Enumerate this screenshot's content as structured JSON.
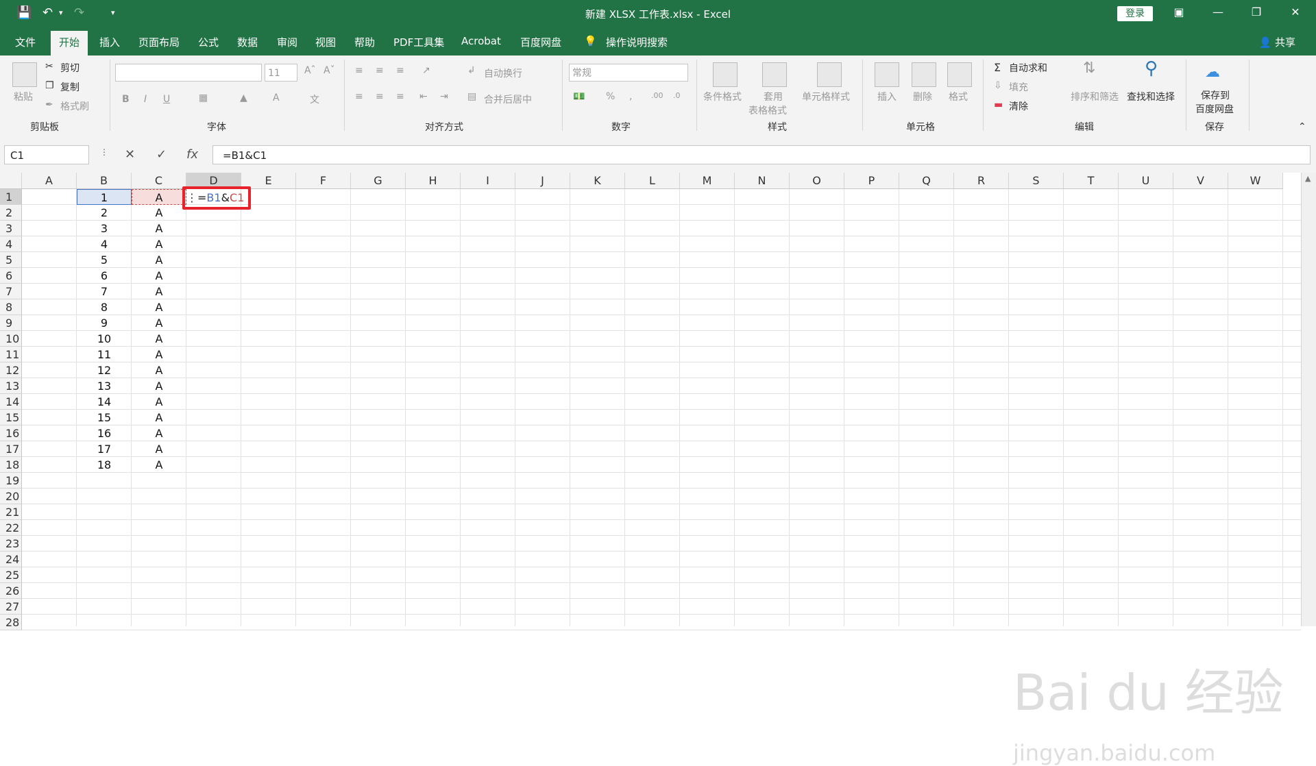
{
  "window": {
    "title": "新建 XLSX 工作表.xlsx  -  Excel",
    "login": "登录"
  },
  "tabs": [
    "文件",
    "开始",
    "插入",
    "页面布局",
    "公式",
    "数据",
    "审阅",
    "视图",
    "帮助",
    "PDF工具集",
    "Acrobat",
    "百度网盘"
  ],
  "tell_me": "操作说明搜索",
  "share": "共享",
  "ribbon": {
    "clipboard": {
      "label": "剪贴板",
      "paste": "粘贴",
      "cut": "剪切",
      "copy": "复制",
      "format_painter": "格式刷"
    },
    "font": {
      "label": "字体",
      "size": "11",
      "bold": "B",
      "italic": "I",
      "underline": "U"
    },
    "alignment": {
      "label": "对齐方式",
      "wrap": "自动换行",
      "merge": "合并后居中"
    },
    "number": {
      "label": "数字",
      "format": "常规"
    },
    "styles": {
      "label": "样式",
      "conditional": "条件格式",
      "table_1": "套用",
      "table_2": "表格格式",
      "cell_styles": "单元格样式"
    },
    "cells": {
      "label": "单元格",
      "insert": "插入",
      "delete": "删除",
      "format": "格式"
    },
    "editing": {
      "label": "编辑",
      "autosum": "自动求和",
      "fill": "填充",
      "clear": "清除",
      "sort": "排序和筛选",
      "find": "查找和选择"
    },
    "save": {
      "label": "保存",
      "save_1": "保存到",
      "save_2": "百度网盘"
    }
  },
  "name_box": "C1",
  "formula": "=B1&C1",
  "columns": [
    "A",
    "B",
    "C",
    "D",
    "E",
    "F",
    "G",
    "H",
    "I",
    "J",
    "K",
    "L",
    "M",
    "N",
    "O",
    "P",
    "Q",
    "R",
    "S",
    "T",
    "U",
    "V",
    "W"
  ],
  "rows": [
    "1",
    "2",
    "3",
    "4",
    "5",
    "6",
    "7",
    "8",
    "9",
    "10",
    "11",
    "12",
    "13",
    "14",
    "15",
    "16",
    "17",
    "18",
    "19",
    "20",
    "21",
    "22",
    "23",
    "24",
    "25",
    "26",
    "27",
    "28"
  ],
  "col_b": [
    "1",
    "2",
    "3",
    "4",
    "5",
    "6",
    "7",
    "8",
    "9",
    "10",
    "11",
    "12",
    "13",
    "14",
    "15",
    "16",
    "17",
    "18"
  ],
  "col_c": [
    "A",
    "A",
    "A",
    "A",
    "A",
    "A",
    "A",
    "A",
    "A",
    "A",
    "A",
    "A",
    "A",
    "A",
    "A",
    "A",
    "A",
    "A"
  ],
  "d1_edit": {
    "eq": "=",
    "b1": "B1",
    "amp": "&",
    "c1": "C1"
  },
  "watermark": {
    "brand": "Bai du 经验",
    "url": "jingyan.baidu.com"
  },
  "colors": {
    "excel_green": "#217346",
    "ref_blue": "#4472c4",
    "ref_red": "#c0504d",
    "highlight": "#e8222a"
  }
}
